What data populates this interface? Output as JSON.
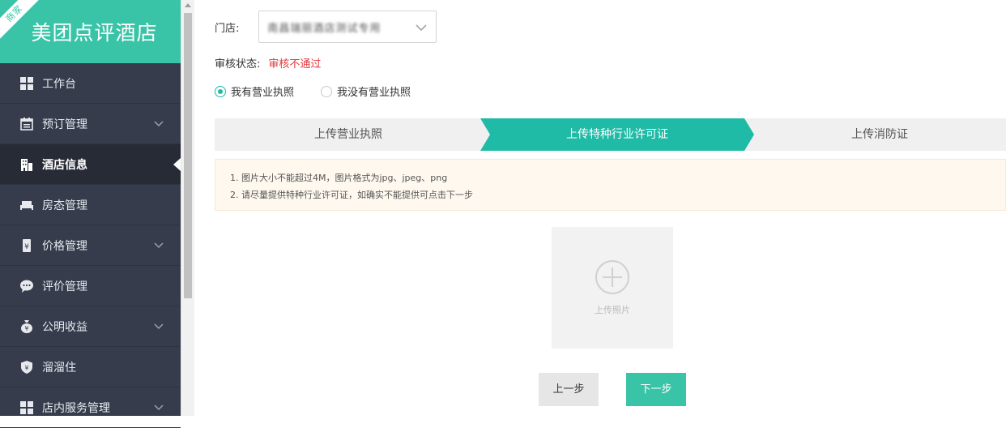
{
  "brand": {
    "corner_tag": "商家",
    "title": "美团点评酒店"
  },
  "sidebar": {
    "items": [
      {
        "label": "工作台",
        "icon": "dashboard-icon",
        "has_submenu": false,
        "active": false
      },
      {
        "label": "预订管理",
        "icon": "calendar-icon",
        "has_submenu": true,
        "active": false
      },
      {
        "label": "酒店信息",
        "icon": "building-icon",
        "has_submenu": false,
        "active": true
      },
      {
        "label": "房态管理",
        "icon": "bed-icon",
        "has_submenu": false,
        "active": false
      },
      {
        "label": "价格管理",
        "icon": "price-tag-icon",
        "has_submenu": true,
        "active": false
      },
      {
        "label": "评价管理",
        "icon": "chat-icon",
        "has_submenu": false,
        "active": false
      },
      {
        "label": "公明收益",
        "icon": "money-bag-icon",
        "has_submenu": true,
        "active": false
      },
      {
        "label": "溜溜住",
        "icon": "shield-yen-icon",
        "has_submenu": false,
        "active": false
      },
      {
        "label": "店内服务管理",
        "icon": "grid-icon",
        "has_submenu": true,
        "active": false
      }
    ]
  },
  "form": {
    "store_label": "门店:",
    "store_value": "南昌瑞丽酒店测试专用",
    "status_label": "审核状态:",
    "status_value": "审核不通过",
    "radio_have_license": "我有营业执照",
    "radio_no_license": "我没有营业执照",
    "selected_radio": "have"
  },
  "steps": [
    {
      "label": "上传营业执照",
      "active": false
    },
    {
      "label": "上传特种行业许可证",
      "active": true
    },
    {
      "label": "上传消防证",
      "active": false
    }
  ],
  "notice": {
    "line1": "1. 图片大小不能超过4M，图片格式为jpg、jpeg、png",
    "line2": "2. 请尽量提供特种行业许可证，如确实不能提供可点击下一步"
  },
  "upload": {
    "label": "上传照片",
    "icon": "plus-circle-icon"
  },
  "buttons": {
    "prev": "上一步",
    "next": "下一步"
  },
  "colors": {
    "accent": "#3ac4a7",
    "step_active": "#1fbba6",
    "sidebar_bg": "#363c4c",
    "error": "#e4393c"
  }
}
